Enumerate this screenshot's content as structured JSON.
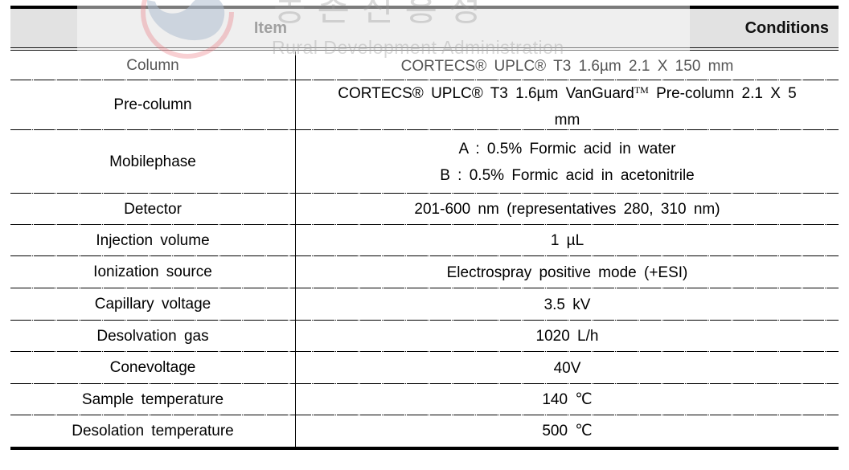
{
  "table": {
    "headers": {
      "item": "Item",
      "conditions": "Conditions"
    },
    "rows": [
      {
        "item": "Column",
        "conditions": [
          "CORTECS®   UPLC® T3  1.6µm  2.1  X  150  mm"
        ]
      },
      {
        "item": "Pre-column",
        "conditions": [
          "CORTECS®  UPLC®  T3  1.6µm   VanGuard",
          "Pre-column  2.1  X  5",
          "mm"
        ],
        "trademark": "TM"
      },
      {
        "item": "Mobilephase",
        "conditions": [
          "A  :  0.5%  Formic  acid  in   water",
          "B   :  0.5%  Formic  acid  in  acetonitrile"
        ]
      },
      {
        "item": "Detector",
        "conditions": [
          "201-600  nm   (representatives  280,  310  nm)"
        ]
      },
      {
        "item": "Injection    volume",
        "conditions": [
          "1  µL"
        ]
      },
      {
        "item": "Ionization    source",
        "conditions": [
          "Electrospray  positive   mode  (+ESI)"
        ]
      },
      {
        "item": "Capillary    voltage",
        "conditions": [
          "3.5  kV"
        ]
      },
      {
        "item": "Desolvation    gas",
        "conditions": [
          "1020  L/h"
        ]
      },
      {
        "item": "Conevoltage",
        "conditions": [
          "40V"
        ]
      },
      {
        "item": "Sample    temperature",
        "conditions": [
          "140  ℃"
        ]
      },
      {
        "item": "Desolation    temperature",
        "conditions": [
          "500  ℃"
        ]
      }
    ]
  },
  "watermark": {
    "korean_text": "농촌진흥청",
    "english_text": "Rural Development Administration",
    "logo_icon": "taegeuk-swirl-logo",
    "colors": {
      "blue": "#c9d3de",
      "red": "#f1a7ad"
    }
  }
}
